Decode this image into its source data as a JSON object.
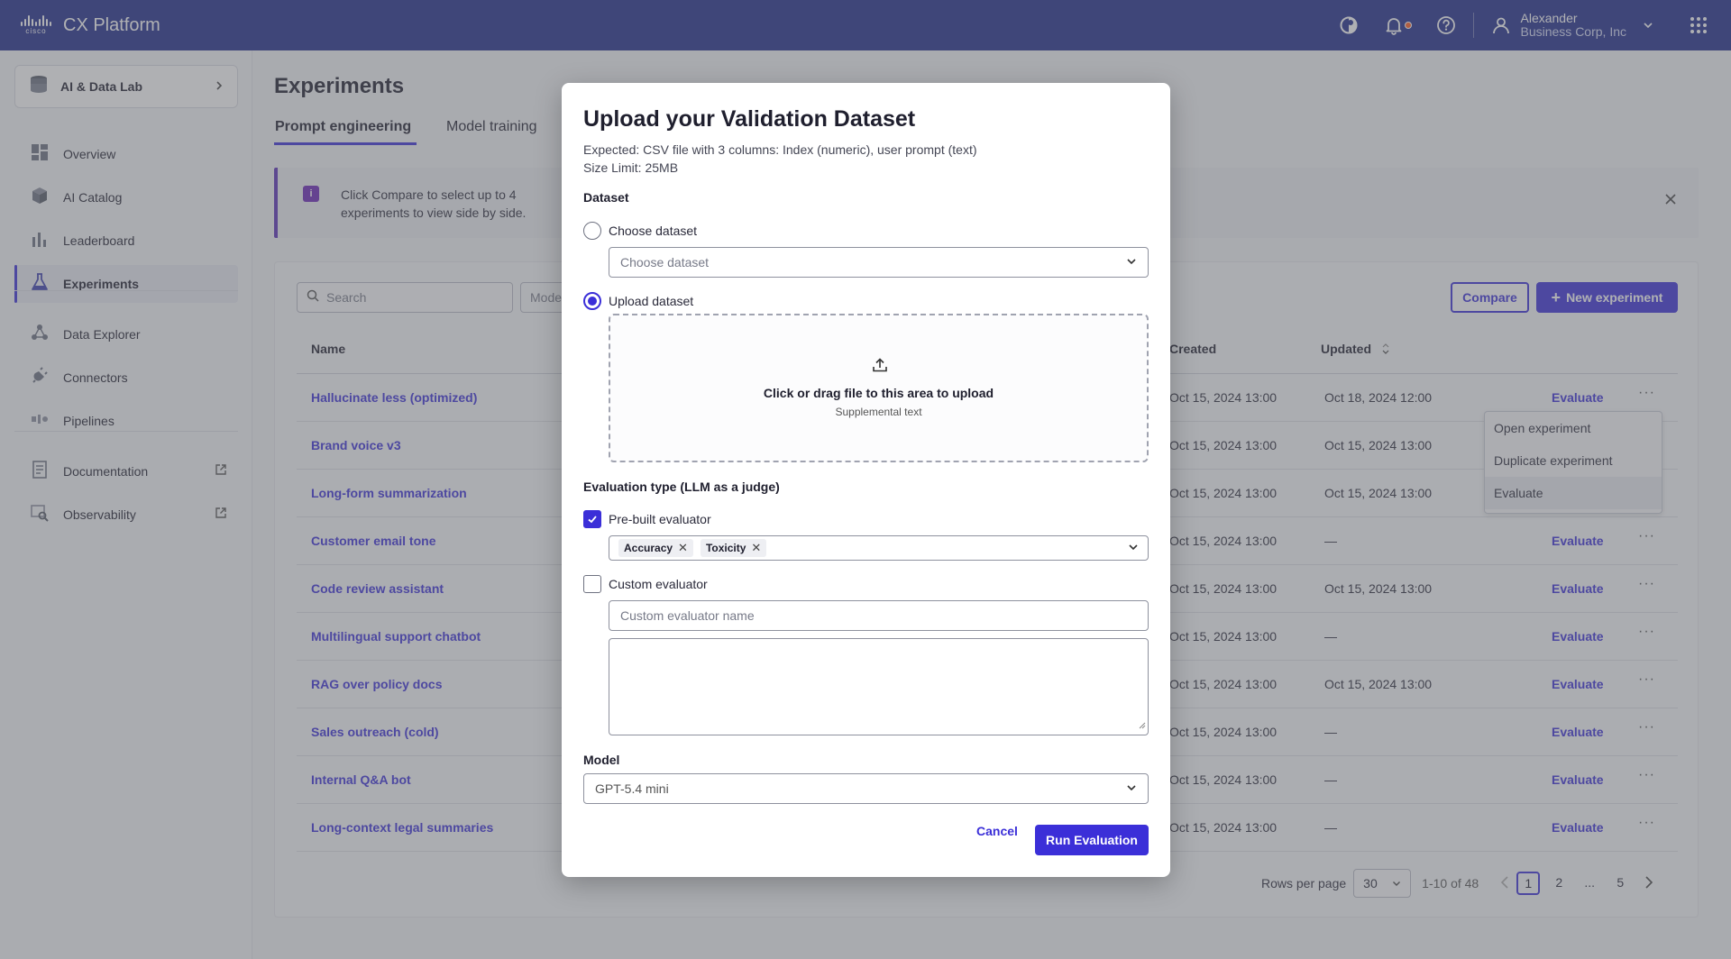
{
  "topbar": {
    "logo_text": "cisco",
    "title": "CX Platform",
    "user_name": "Alexander",
    "user_org": "Business Corp, Inc",
    "icons": [
      "theme-icon",
      "bell-icon",
      "help-icon",
      "user-icon",
      "chevron-down-icon",
      "apps-grid-icon"
    ]
  },
  "sidebar": {
    "lab": "AI & Data Lab",
    "items": [
      {
        "label": "Overview",
        "icon": "overview-icon"
      },
      {
        "label": "AI Catalog",
        "icon": "cube-icon"
      },
      {
        "label": "Leaderboard",
        "icon": "bar-chart-icon"
      },
      {
        "label": "Experiments",
        "icon": "flask-icon",
        "active": true
      },
      {
        "label": "Data Explorer",
        "icon": "nodes-icon"
      },
      {
        "label": "Connectors",
        "icon": "plug-icon"
      },
      {
        "label": "Pipelines",
        "icon": "pipeline-icon"
      },
      {
        "label": "Documentation",
        "icon": "document-icon",
        "external": true
      },
      {
        "label": "Observability",
        "icon": "observability-icon",
        "external": true
      }
    ]
  },
  "main": {
    "title": "Experiments",
    "tabs": [
      "Prompt engineering",
      "Model training"
    ],
    "banner": "Click Compare to select up to 4 experiments to view side by side.",
    "search_placeholder": "Search",
    "model_filter": "Model",
    "compare_label": "Compare",
    "new_label": "New experiment",
    "columns": {
      "name": "Name",
      "created": "Created",
      "updated": "Updated"
    },
    "evaluate_label": "Evaluate",
    "more_label": "···",
    "rows": [
      {
        "name": "Hallucinate less (optimized)",
        "created": "Oct 15, 2024 13:00",
        "updated": "Oct 18, 2024 12:00"
      },
      {
        "name": "Brand voice v3",
        "created": "Oct 15, 2024 13:00",
        "updated": "Oct 15, 2024 13:00"
      },
      {
        "name": "Long-form summarization",
        "created": "Oct 15, 2024 13:00",
        "updated": "Oct 15, 2024 13:00"
      },
      {
        "name": "Customer email tone",
        "created": "Oct 15, 2024 13:00",
        "updated": "—"
      },
      {
        "name": "Code review assistant",
        "created": "Oct 15, 2024 13:00",
        "updated": "Oct 15, 2024 13:00"
      },
      {
        "name": "Multilingual support chatbot",
        "created": "Oct 15, 2024 13:00",
        "updated": "—"
      },
      {
        "name": "RAG over policy docs",
        "created": "Oct 15, 2024 13:00",
        "updated": "Oct 15, 2024 13:00"
      },
      {
        "name": "Sales outreach (cold)",
        "created": "Oct 15, 2024 13:00",
        "updated": "—"
      },
      {
        "name": "Internal Q&A bot",
        "created": "Oct 15, 2024 13:00",
        "updated": "—"
      },
      {
        "name": "Long-context legal summaries",
        "created": "Oct 15, 2024 13:00",
        "updated": "—"
      }
    ],
    "context_menu": [
      "Open experiment",
      "Duplicate experiment",
      "Evaluate"
    ],
    "pagination": {
      "rows_per_page_label": "Rows per page",
      "rows_per_page": "30",
      "range": "1-10 of 48",
      "pages": [
        "1",
        "2",
        "...",
        "5"
      ],
      "current": "1"
    }
  },
  "modal": {
    "title": "Upload your Validation Dataset",
    "expected": "Expected: CSV file with 3 columns: Index (numeric), user prompt (text)",
    "size_limit": "Size Limit: 25MB",
    "dataset_label": "Dataset",
    "choose_option": "Choose dataset",
    "choose_placeholder": "Choose dataset",
    "upload_option": "Upload dataset",
    "upload_main": "Click or drag file to this area to upload",
    "upload_sub": "Supplemental text",
    "eval_type_label": "Evaluation type (LLM as a judge)",
    "prebuilt_label": "Pre-built evaluator",
    "prebuilt_checked": true,
    "chips": [
      "Accuracy",
      "Toxicity"
    ],
    "custom_label": "Custom evaluator",
    "custom_checked": false,
    "custom_name_placeholder": "Custom evaluator name",
    "model_label": "Model",
    "model_value": "GPT-5.4 mini",
    "cancel_label": "Cancel",
    "run_label": "Run Evaluation"
  },
  "colors": {
    "topbar": "#1e2a8a",
    "accent": "#3b2fd8",
    "info": "#6a25b8"
  }
}
